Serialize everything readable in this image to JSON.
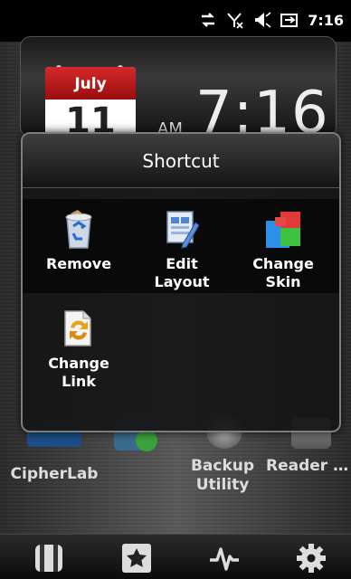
{
  "status_bar": {
    "time": "7:16",
    "icons": [
      "sync-arrows-icon",
      "no-signal-icon",
      "speaker-mute-icon",
      "battery-charging-icon"
    ]
  },
  "clock_widget": {
    "month": "July",
    "day": "11",
    "ampm": "AM",
    "time": "7:16"
  },
  "background_apps": [
    {
      "label": "CipherLab"
    },
    {
      "label": "Backup Utility"
    },
    {
      "label": "Reader Configur..."
    }
  ],
  "popup": {
    "title": "Shortcut",
    "items": [
      {
        "label_line1": "Remove",
        "label_line2": "",
        "icon": "recycle-bin-icon"
      },
      {
        "label_line1": "Edit",
        "label_line2": "Layout",
        "icon": "edit-layout-icon"
      },
      {
        "label_line1": "Change",
        "label_line2": "Skin",
        "icon": "change-skin-icon"
      },
      {
        "label_line1": "Change",
        "label_line2": "Link",
        "icon": "change-link-icon"
      }
    ]
  },
  "bottom_bar": {
    "buttons": [
      "phone-slider-icon",
      "favorites-star-icon",
      "activity-pulse-icon",
      "settings-gear-icon"
    ]
  },
  "colors": {
    "calendar_red": "#c41c1c",
    "popup_border": "#7d7d7d",
    "background": "#3a3a3a"
  }
}
